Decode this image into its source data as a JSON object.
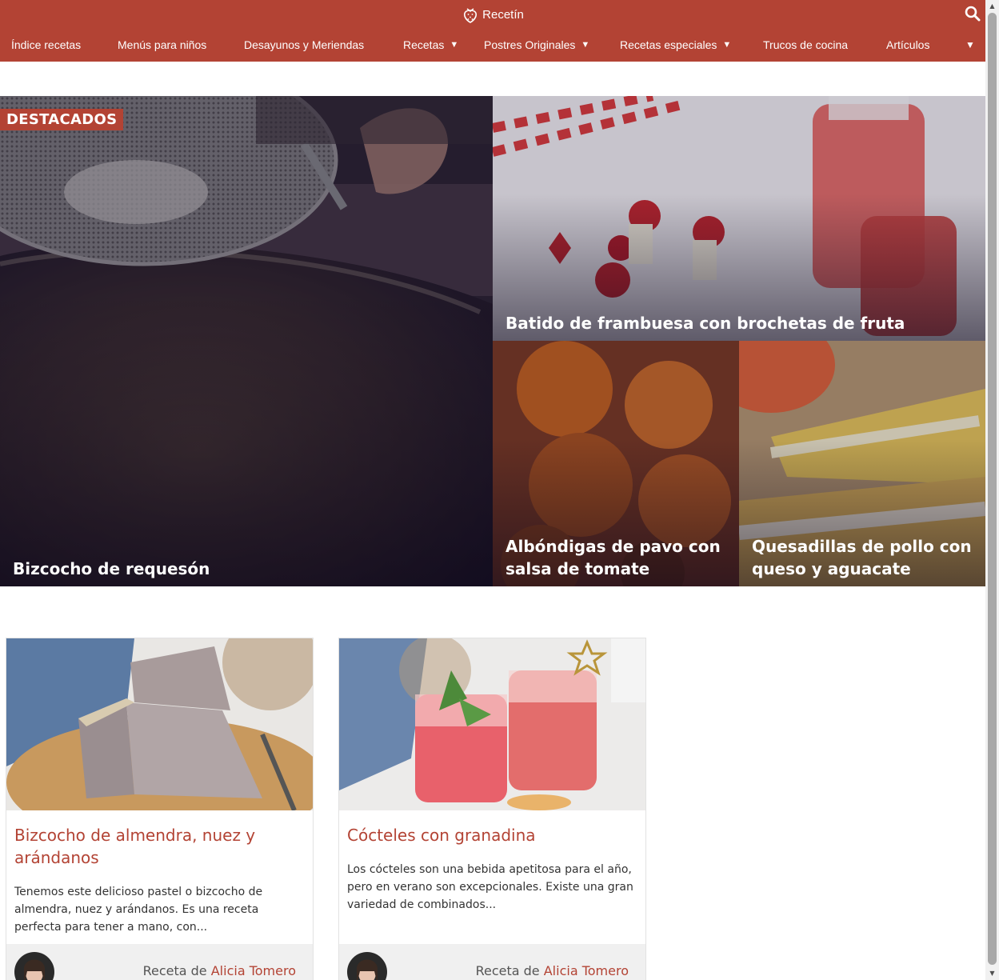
{
  "brand": {
    "name": "Recetín"
  },
  "colors": {
    "accent": "#b34334",
    "white": "#ffffff"
  },
  "icons": {
    "brand": "strawberry-icon",
    "search": "search-icon",
    "dropdown": "caret-down-icon"
  },
  "nav": {
    "items": [
      {
        "label": "Índice recetas"
      },
      {
        "label": "Menús para niños"
      },
      {
        "label": "Desayunos y Meriendas"
      },
      {
        "label": "Recetas",
        "dropdown": true
      },
      {
        "label": "Postres Originales",
        "dropdown": true
      },
      {
        "label": "Recetas especiales",
        "dropdown": true
      },
      {
        "label": "Trucos de cocina"
      },
      {
        "label": "Artículos"
      }
    ],
    "more_caret": "▾"
  },
  "featured": {
    "badge": "DESTACADOS",
    "tiles": [
      {
        "title": "Bizcocho de requesón"
      },
      {
        "title": "Batido de frambuesa con brochetas de fruta"
      },
      {
        "title": "Albóndigas de pavo con salsa de tomate"
      },
      {
        "title": "Quesadillas de pollo con queso y aguacate"
      }
    ]
  },
  "cards": [
    {
      "title": "Bizcocho de almendra, nuez y arándanos",
      "excerpt": "Tenemos este delicioso pastel o bizcocho de almendra, nuez y arándanos. Es una receta perfecta para tener a mano, con...",
      "byline_prefix": "Receta de",
      "author": "Alicia Tomero"
    },
    {
      "title": "Cócteles con granadina",
      "excerpt": "Los cócteles son una bebida apetitosa para el año, pero en verano son excepcionales. Existe una gran variedad de combinados...",
      "byline_prefix": "Receta de",
      "author": "Alicia Tomero"
    }
  ]
}
